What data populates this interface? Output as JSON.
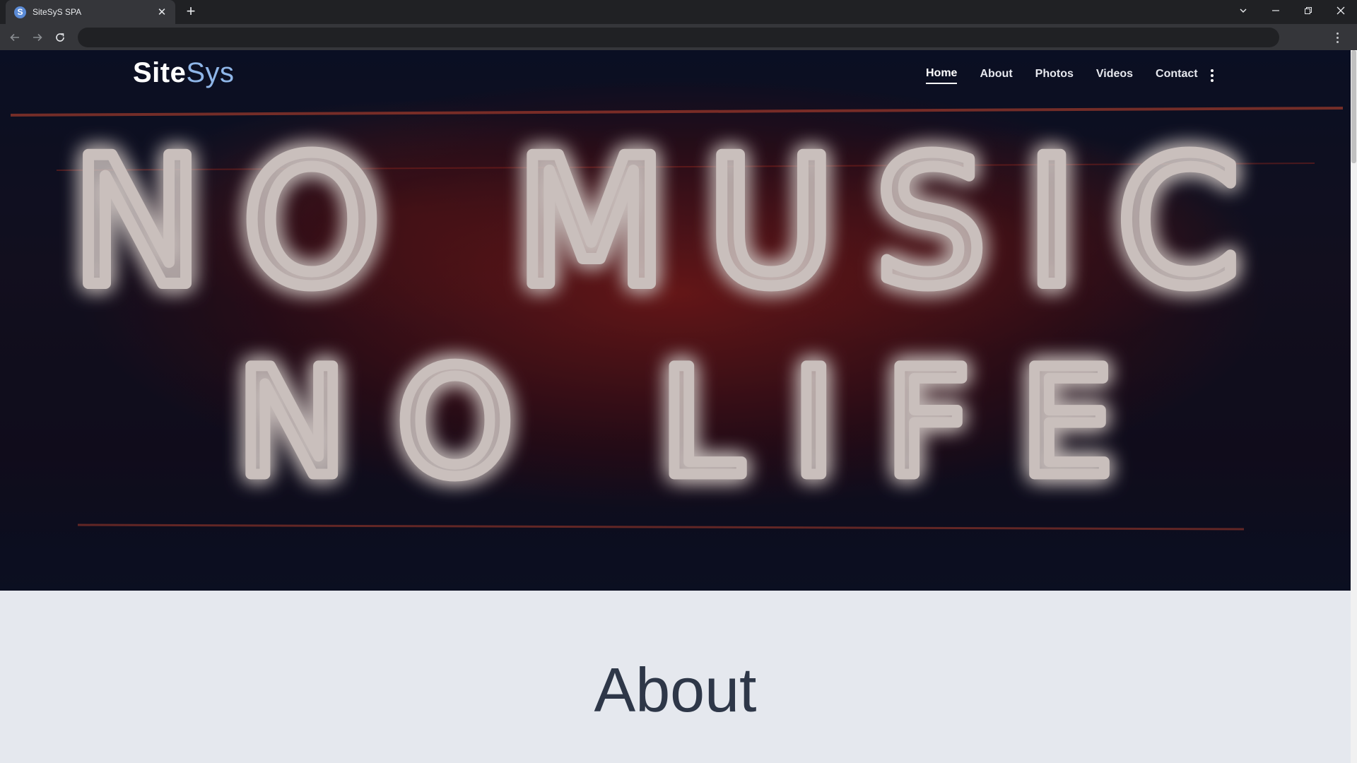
{
  "browser": {
    "tab_title": "SiteSyS SPA",
    "favicon_letter": "S",
    "address": ""
  },
  "site": {
    "logo_primary": "Site",
    "logo_secondary": "Sys",
    "nav": [
      {
        "label": "Home",
        "active": true
      },
      {
        "label": "About",
        "active": false
      },
      {
        "label": "Photos",
        "active": false
      },
      {
        "label": "Videos",
        "active": false
      },
      {
        "label": "Contact",
        "active": false
      }
    ]
  },
  "hero": {
    "neon_line1": "NO MUSIC",
    "neon_line2": "NO LIFE"
  },
  "section": {
    "heading": "About"
  },
  "colors": {
    "neon_glow": "#ff4a2a",
    "neon_tube": "#fff4ee",
    "page_bg": "#e5e8ee",
    "heading": "#2e3748"
  }
}
